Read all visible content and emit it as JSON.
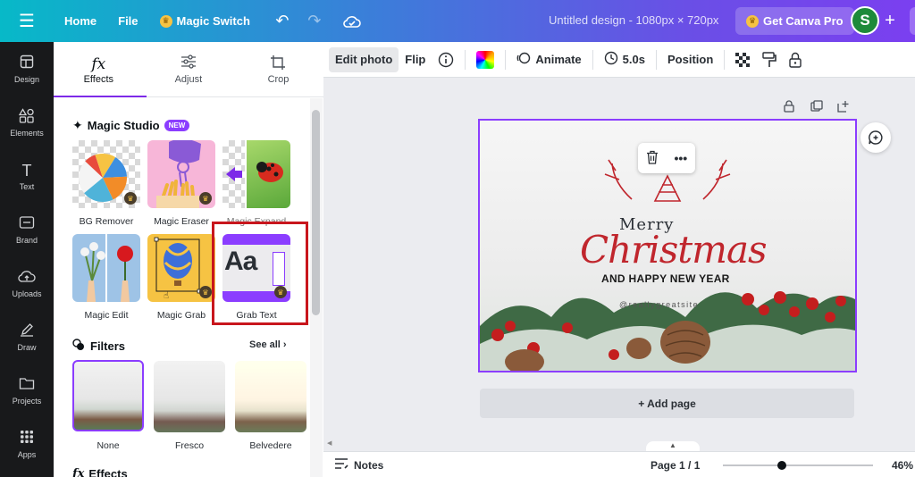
{
  "topbar": {
    "home": "Home",
    "file": "File",
    "magic_switch": "Magic Switch",
    "title": "Untitled design - 1080px × 720px",
    "get_pro": "Get Canva Pro",
    "avatar_letter": "S"
  },
  "rail": {
    "items": [
      {
        "label": "Design",
        "icon": "layout-icon"
      },
      {
        "label": "Elements",
        "icon": "shapes-icon"
      },
      {
        "label": "Text",
        "icon": "text-icon"
      },
      {
        "label": "Brand",
        "icon": "brand-icon"
      },
      {
        "label": "Uploads",
        "icon": "cloud-upload-icon"
      },
      {
        "label": "Draw",
        "icon": "pen-icon"
      },
      {
        "label": "Projects",
        "icon": "folder-icon"
      },
      {
        "label": "Apps",
        "icon": "grid-icon"
      }
    ]
  },
  "panel": {
    "tabs": [
      {
        "label": "Effects",
        "icon": "fx"
      },
      {
        "label": "Adjust",
        "icon": "sliders-icon"
      },
      {
        "label": "Crop",
        "icon": "crop-icon"
      }
    ],
    "magic_studio": {
      "title": "Magic Studio",
      "badge": "NEW",
      "tools": [
        {
          "label": "BG Remover"
        },
        {
          "label": "Magic Eraser"
        },
        {
          "label": "Magic Expand"
        },
        {
          "label": "Magic Edit"
        },
        {
          "label": "Magic Grab"
        },
        {
          "label": "Grab Text"
        }
      ],
      "grab_text_preview": "Aa"
    },
    "filters": {
      "title": "Filters",
      "see_all": "See all",
      "items": [
        {
          "label": "None"
        },
        {
          "label": "Fresco"
        },
        {
          "label": "Belvedere"
        }
      ]
    },
    "effects_title": "Effects"
  },
  "context_toolbar": {
    "edit_photo": "Edit photo",
    "flip": "Flip",
    "animate": "Animate",
    "duration": "5.0s",
    "position": "Position"
  },
  "design": {
    "merry": "Merry",
    "christmas": "Christmas",
    "subtitle": "AND HAPPY NEW YEAR",
    "handle": "@reallygreatsite"
  },
  "float_bar": {
    "more": "•••"
  },
  "canvas": {
    "add_page": "+ Add page"
  },
  "bottombar": {
    "notes": "Notes",
    "page": "Page 1 / 1",
    "zoom": "46%",
    "zoom_level": 0.46
  },
  "colors": {
    "accent": "#8b3dff",
    "highlight_box": "#c8161d",
    "christmas_red": "#c0262d",
    "rail_bg": "#18191b"
  }
}
